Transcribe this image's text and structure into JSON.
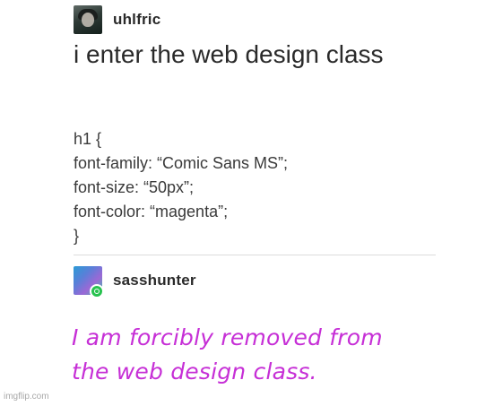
{
  "post1": {
    "username": "uhlfric",
    "headline": "i enter the web design class",
    "code_lines": [
      "h1 {",
      "font-family: “Comic Sans MS”;",
      "font-size: “50px”;",
      "font-color: “magenta”;",
      "}"
    ]
  },
  "post2": {
    "username": "sasshunter",
    "reply_lines": [
      "I am forcibly removed from",
      "the web design class."
    ]
  },
  "watermark": "imgflip.com",
  "colors": {
    "reply_text": "#c62fd6",
    "body_text": "#2a2a2a",
    "reblog_badge": "#28c24f"
  },
  "icons": {
    "avatar_1": "user-avatar-icon",
    "avatar_2": "user-avatar-icon",
    "reblog_badge": "reblog-icon"
  }
}
